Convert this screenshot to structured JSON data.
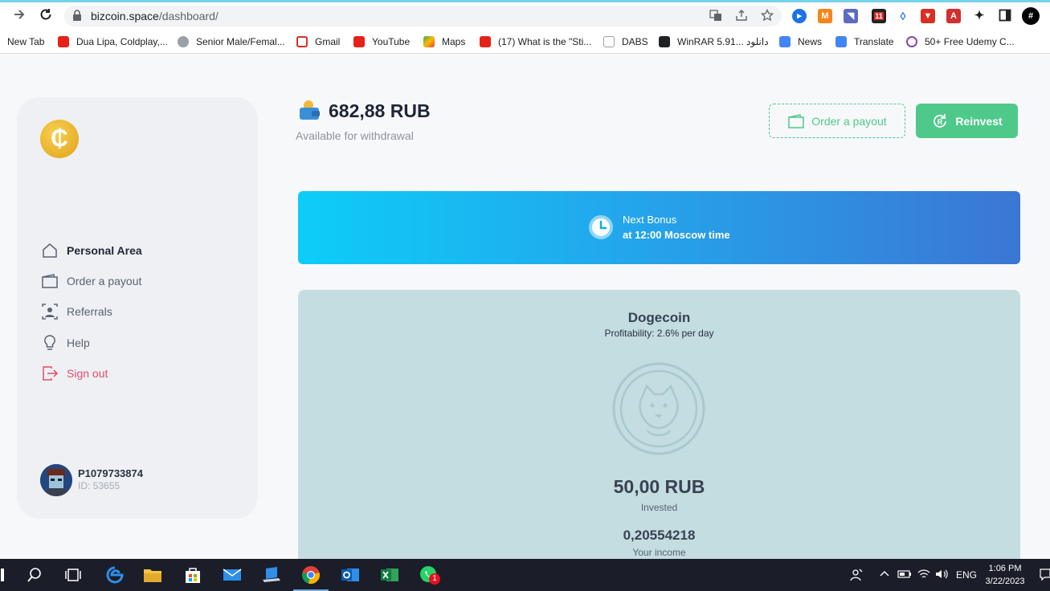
{
  "browser": {
    "url_host": "bizcoin.space",
    "url_path": "/dashboard/",
    "bookmarks": [
      {
        "label": "New Tab",
        "color": "#e24c3b"
      },
      {
        "label": "Dua Lipa, Coldplay,...",
        "color": "#e62117"
      },
      {
        "label": "Senior Male/Femal...",
        "color": "#777777"
      },
      {
        "label": "Gmail",
        "color": "#d93025"
      },
      {
        "label": "YouTube",
        "color": "#e62117"
      },
      {
        "label": "Maps",
        "color": "#34a853"
      },
      {
        "label": "(17) What is the \"Sti...",
        "color": "#e62117"
      },
      {
        "label": "DABS",
        "color": "#9aa0a6"
      },
      {
        "label": "WinRAR 5.91... دانلود",
        "color": "#202124"
      },
      {
        "label": "News",
        "color": "#4285f4"
      },
      {
        "label": "Translate",
        "color": "#4285f4"
      },
      {
        "label": "50+ Free Udemy C...",
        "color": "#8e44ad"
      }
    ],
    "extension_badge": "11"
  },
  "sidebar": {
    "logo_glyph": "₵",
    "nav": [
      {
        "label": "Personal Area",
        "icon": "home-icon"
      },
      {
        "label": "Order a payout",
        "icon": "wallet-icon"
      },
      {
        "label": "Referrals",
        "icon": "user-badge-icon"
      },
      {
        "label": "Help",
        "icon": "lightbulb-icon"
      },
      {
        "label": "Sign out",
        "icon": "sign-out-icon"
      }
    ],
    "user": {
      "name": "P1079733874",
      "id": "ID: 53655"
    }
  },
  "header": {
    "balance": "682,88 RUB",
    "balance_label": "Available for withdrawal",
    "order_button": "Order a payout",
    "reinvest_button": "Reinvest"
  },
  "bonus": {
    "line1": "Next Bonus",
    "line2": "at 12:00 Moscow time"
  },
  "plan": {
    "name": "Dogecoin",
    "profitability": "Profitability: 2.6% per day",
    "invested": "50,00 RUB",
    "invested_label": "Invested",
    "income": "0,20554218",
    "income_label": "Your income"
  },
  "taskbar": {
    "language": "ENG",
    "time": "1:06 PM",
    "date": "3/22/2023",
    "whatsapp_badge": "1"
  },
  "colors": {
    "accent_green": "#4fc98a",
    "sign_out_red": "#e24c6e",
    "plan_bg": "#c3dde1"
  }
}
